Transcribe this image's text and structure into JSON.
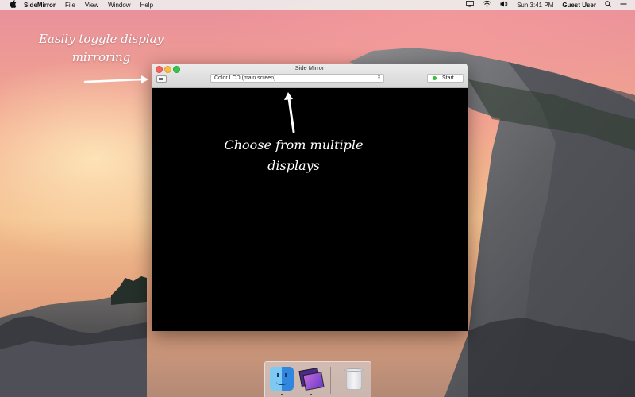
{
  "menubar": {
    "apple_icon": "apple-icon",
    "app_name": "SideMirror",
    "menus": [
      "File",
      "View",
      "Window",
      "Help"
    ],
    "status_icons": [
      "airplay-icon",
      "wifi-icon",
      "volume-icon"
    ],
    "clock": "Sun 3:41 PM",
    "user": "Guest User",
    "search_icon": "search-icon",
    "list_icon": "list-icon"
  },
  "window": {
    "title": "Side Mirror",
    "display_select": {
      "value": "Color LCD (main screen)"
    },
    "start_label": "Start",
    "status_color": "#2ec438"
  },
  "annotations": {
    "toggle_line1": "Easily toggle display",
    "toggle_line2": "mirroring",
    "displays_line1": "Choose from multiple",
    "displays_line2": "displays"
  },
  "dock": {
    "items": [
      "finder-icon",
      "sidemirror-icon",
      "trash-icon"
    ]
  }
}
